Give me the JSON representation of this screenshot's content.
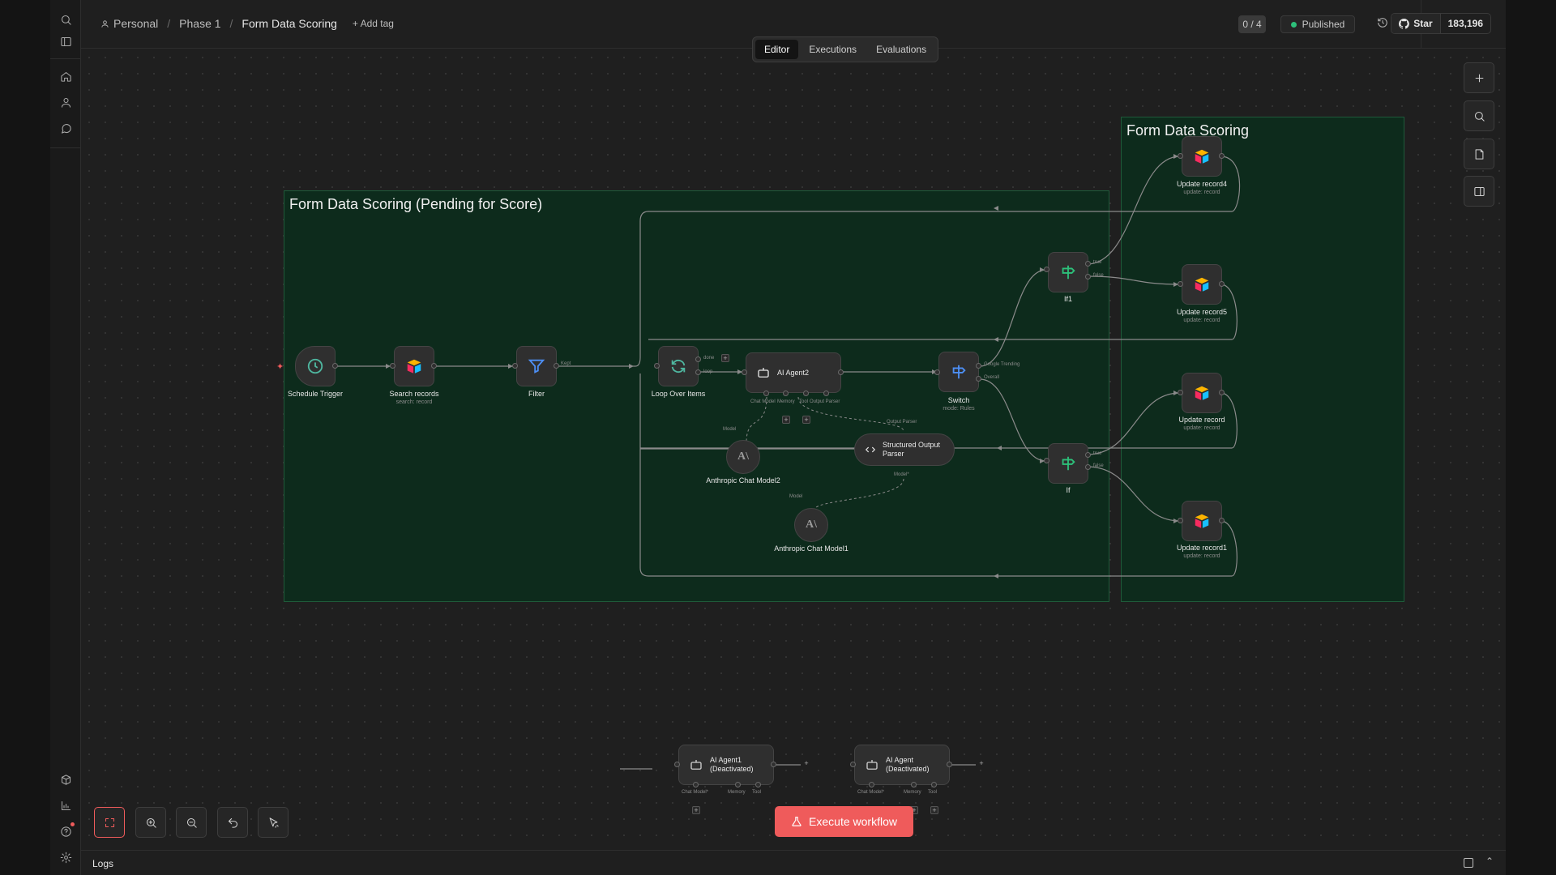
{
  "breadcrumb": {
    "personal": "Personal",
    "project": "Phase 1",
    "workflow": "Form Data Scoring",
    "add_tag": "+ Add tag"
  },
  "header": {
    "counter": "0 / 4",
    "status": "Published",
    "github_star": "Star",
    "github_count": "183,196"
  },
  "tabs": [
    {
      "label": "Editor",
      "active": true
    },
    {
      "label": "Executions",
      "active": false
    },
    {
      "label": "Evaluations",
      "active": false
    }
  ],
  "stickies": {
    "pending": "Form Data Scoring (Pending for Score)",
    "scoring": "Form Data Scoring"
  },
  "nodes": {
    "schedule": {
      "label": "Schedule Trigger"
    },
    "search": {
      "label": "Search records",
      "sub": "search: record"
    },
    "filter": {
      "label": "Filter"
    },
    "loop": {
      "label": "Loop Over Items"
    },
    "agent2": {
      "label": "AI Agent2"
    },
    "switch": {
      "label": "Switch",
      "sub": "mode: Rules"
    },
    "model2": {
      "label": "Anthropic Chat Model2"
    },
    "parser": {
      "label": "Structured Output Parser"
    },
    "model1": {
      "label": "Anthropic Chat Model1"
    },
    "if1": {
      "label": "If1"
    },
    "if": {
      "label": "If"
    },
    "update4": {
      "label": "Update record4",
      "sub": "update: record"
    },
    "update5": {
      "label": "Update record5",
      "sub": "update: record"
    },
    "update": {
      "label": "Update record",
      "sub": "update: record"
    },
    "update1": {
      "label": "Update record1",
      "sub": "update: record"
    },
    "agent1": {
      "label": "AI Agent1 (Deactivated)"
    },
    "agent": {
      "label": "AI Agent (Deactivated)"
    }
  },
  "port_labels": {
    "kept": "Kept",
    "done": "done",
    "loop": "loop",
    "chat_model": "Chat Model",
    "memory": "Memory",
    "tool": "Tool",
    "output_parser": "Output Parser",
    "model": "Model",
    "model_req": "Model*",
    "chat_model_req": "Chat Model*",
    "google_trending": "Google Trending",
    "overall": "Overall",
    "true": "true",
    "false": "false"
  },
  "execute_button": "Execute workflow",
  "logs": {
    "title": "Logs"
  },
  "colors": {
    "accent": "#ef5b5b",
    "sticky_bg": "#0d2b1c",
    "published": "#2dc07a"
  }
}
